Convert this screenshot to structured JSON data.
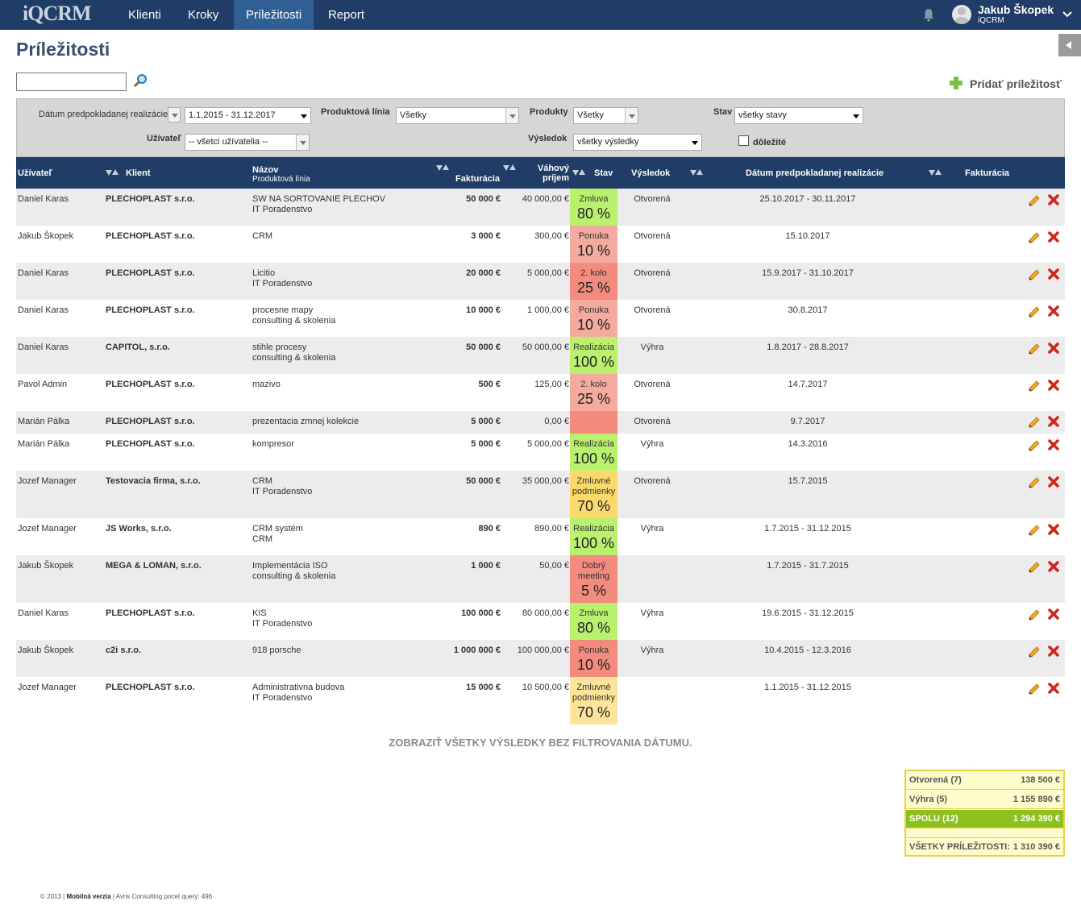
{
  "app": {
    "logo": "iQCRM"
  },
  "nav": [
    {
      "label": "Klienti",
      "active": false
    },
    {
      "label": "Kroky",
      "active": false
    },
    {
      "label": "Príležitosti",
      "active": true
    },
    {
      "label": "Report",
      "active": false
    }
  ],
  "user": {
    "name": "Jakub Škopek",
    "company": "iQCRM"
  },
  "page": {
    "title": "Príležitosti",
    "add_label": "Pridať príležitosť"
  },
  "search": {
    "value": "",
    "placeholder": ""
  },
  "filters": {
    "date_label": "Dátum predpokladanej realizácie",
    "date_value": "1.1.2015 - 31.12.2017",
    "line_label": "Produktová línia",
    "line_value": "Všetky",
    "products_label": "Produkty",
    "products_value": "Všetky",
    "stav_label": "Stav",
    "stav_value": "všetky stavy",
    "user_label": "Užívateľ",
    "user_value": "-- všetci užívatelia --",
    "result_label": "Výsledok",
    "result_value": "všetky výsledky",
    "important_label": "dôležité",
    "important_checked": false
  },
  "columns": {
    "user": "Užívateľ",
    "client": "Klient",
    "name": "Názov",
    "name_sub": "Produktová línia",
    "fakturacia": "Fakturácia",
    "vahovy1": "Váhový",
    "vahovy2": "príjem",
    "stav": "Stav",
    "vysledok": "Výsledok",
    "datum": "Dátum predpokladanej realizácie",
    "fakturacia2": "Fakturácia"
  },
  "status_colors": {
    "green": "#b9f06e",
    "red": "#f38b7e",
    "pink": "#f4aa9e",
    "yellow": "#fbd96a",
    "lightyellow": "#fce49a"
  },
  "rows": [
    {
      "user": "Daniel Karas",
      "client": "PLECHOPLAST s.r.o.",
      "name": "SW NA SORTOVANIE PLECHOV",
      "line": "IT Poradenstvo",
      "fak": "50 000 €",
      "vah": "40 000,00 €",
      "stav_label": "Zmluva",
      "stav_pct": "80 %",
      "color": "green",
      "result": "Otvorená",
      "date": "25.10.2017 - 30.11.2017"
    },
    {
      "user": "Jakub Škopek",
      "client": "PLECHOPLAST s.r.o.",
      "name": "CRM",
      "line": "",
      "fak": "3 000 €",
      "vah": "300,00 €",
      "stav_label": "Ponuka",
      "stav_pct": "10 %",
      "color": "pink",
      "result": "Otvorená",
      "date": "15.10.2017"
    },
    {
      "user": "Daniel Karas",
      "client": "PLECHOPLAST s.r.o.",
      "name": "Licitio",
      "line": "IT Poradenstvo",
      "fak": "20 000 €",
      "vah": "5 000,00 €",
      "stav_label": "2. kolo",
      "stav_pct": "25 %",
      "color": "red",
      "result": "Otvorená",
      "date": "15.9.2017 - 31.10.2017"
    },
    {
      "user": "Daniel Karas",
      "client": "PLECHOPLAST s.r.o.",
      "name": "procesne mapy",
      "line": "consulting & skolenia",
      "fak": "10 000 €",
      "vah": "1 000,00 €",
      "stav_label": "Ponuka",
      "stav_pct": "10 %",
      "color": "pink",
      "result": "Otvorená",
      "date": "30.8.2017"
    },
    {
      "user": "Daniel Karas",
      "client": "CAPITOL, s.r.o.",
      "name": "stihle procesy",
      "line": "consulting & skolenia",
      "fak": "50 000 €",
      "vah": "50 000,00 €",
      "stav_label": "Realizácia",
      "stav_pct": "100 %",
      "color": "green",
      "result": "Výhra",
      "date": "1.8.2017 - 28.8.2017"
    },
    {
      "user": "Pavol Admin",
      "client": "PLECHOPLAST s.r.o.",
      "name": "mazivo",
      "line": "",
      "fak": "500 €",
      "vah": "125,00 €",
      "stav_label": "2. kolo",
      "stav_pct": "25 %",
      "color": "pink",
      "result": "Otvorená",
      "date": "14.7.2017"
    },
    {
      "user": "Marián Pálka",
      "client": "PLECHOPLAST s.r.o.",
      "name": "prezentacia zmnej kolekcie",
      "line": "",
      "fak": "5 000 €",
      "vah": "0,00 €",
      "stav_label": "",
      "stav_pct": "",
      "color": "red",
      "result": "Otvorená",
      "date": "9.7.2017"
    },
    {
      "user": "Marián Pálka",
      "client": "PLECHOPLAST s.r.o.",
      "name": "kompresor",
      "line": "",
      "fak": "5 000 €",
      "vah": "5 000,00 €",
      "stav_label": "Realizácia",
      "stav_pct": "100 %",
      "color": "green",
      "result": "Výhra",
      "date": "14.3.2016"
    },
    {
      "user": "Jozef Manager",
      "client": "Testovacia firma, s.r.o.",
      "name": "CRM",
      "line": "IT Poradenstvo",
      "fak": "50 000 €",
      "vah": "35 000,00 €",
      "stav_label": "Zmluvné podmienky",
      "stav_pct": "70 %",
      "color": "yellow",
      "result": "Otvorená",
      "date": "15.7.2015"
    },
    {
      "user": "Jozef Manager",
      "client": "JS Works, s.r.o.",
      "name": "CRM systém",
      "line": "CRM",
      "fak": "890 €",
      "vah": "890,00 €",
      "stav_label": "Realizácia",
      "stav_pct": "100 %",
      "color": "green",
      "result": "Výhra",
      "date": "1.7.2015 - 31.12.2015"
    },
    {
      "user": "Jakub Škopek",
      "client": "MEGA & LOMAN, s.r.o.",
      "name": "Implementácia ISO",
      "line": "consulting & skolenia",
      "fak": "1 000 €",
      "vah": "50,00 €",
      "stav_label": "Dobrý meeting",
      "stav_pct": "5 %",
      "color": "red",
      "result": "",
      "date": "1.7.2015 - 31.7.2015"
    },
    {
      "user": "Daniel Karas",
      "client": "PLECHOPLAST s.r.o.",
      "name": "KIS",
      "line": "IT Poradenstvo",
      "fak": "100 000 €",
      "vah": "80 000,00 €",
      "stav_label": "Zmluva",
      "stav_pct": "80 %",
      "color": "green",
      "result": "Výhra",
      "date": "19.6.2015 - 31.12.2015"
    },
    {
      "user": "Jakub Škopek",
      "client": "c2i s.r.o.",
      "name": "918 porsche",
      "line": "",
      "fak": "1 000 000 €",
      "vah": "100 000,00 €",
      "stav_label": "Ponuka",
      "stav_pct": "10 %",
      "color": "red",
      "result": "Výhra",
      "date": "10.4.2015 - 12.3.2016"
    },
    {
      "user": "Jozef Manager",
      "client": "PLECHOPLAST s.r.o.",
      "name": "Administrativna budova",
      "line": "IT Poradenstvo",
      "fak": "15 000 €",
      "vah": "10 500,00 €",
      "stav_label": "Zmluvné podmienky",
      "stav_pct": "70 %",
      "color": "lightyellow",
      "result": "",
      "date": "1.1.2015 - 31.12.2015"
    }
  ],
  "show_all_label": "ZOBRAZIŤ VŠETKY VÝSLEDKY BEZ FILTROVANIA DÁTUMU.",
  "summary": {
    "open_label": "Otvorená (7)",
    "open_value": "138 500 €",
    "win_label": "Výhra (5)",
    "win_value": "1 155 890 €",
    "total_label": "SPOLU (12)",
    "total_value": "1 294 390 €",
    "all_label": "VŠETKY PRÍLEŽITOSTI:",
    "all_value": "1 310 390 €"
  },
  "footer": {
    "copy": "© 2013 |",
    "mobile": "Mobilná verzia",
    "rest": "| Avris Consulting pocet query: 496"
  }
}
